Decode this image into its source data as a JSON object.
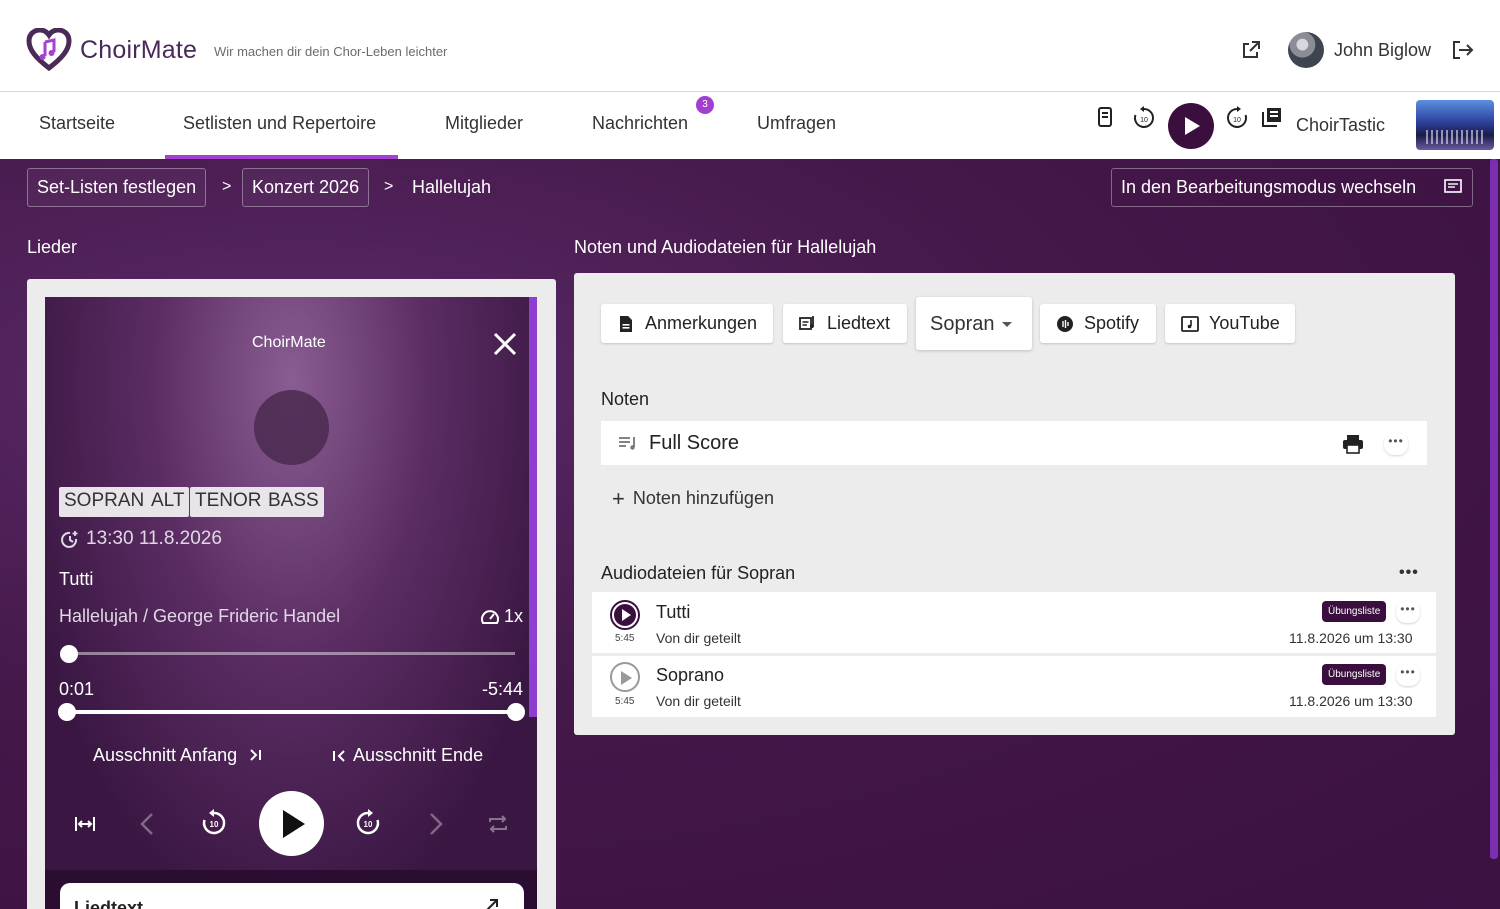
{
  "header": {
    "brand": "ChoirMate",
    "tagline": "Wir machen dir dein Chor-Leben leichter",
    "user_name": "John Biglow"
  },
  "nav": {
    "items": [
      {
        "label": "Startseite"
      },
      {
        "label": "Setlisten und Repertoire"
      },
      {
        "label": "Mitglieder"
      },
      {
        "label": "Nachrichten"
      },
      {
        "label": "Umfragen"
      }
    ],
    "active": "Setlisten und Repertoire",
    "messages_badge": "3",
    "choir_name": "ChoirTastic"
  },
  "breadcrumb": {
    "items": [
      "Set-Listen festlegen",
      "Konzert 2026"
    ],
    "current": "Hallelujah",
    "separator": ">"
  },
  "edit_button": "In den Bearbeitungsmodus wechseln",
  "left": {
    "title": "Lieder",
    "player": {
      "title": "ChoirMate",
      "voices": [
        "SOPRAN",
        "ALT",
        "TENOR",
        "BASS"
      ],
      "datetime": "13:30 11.8.2026",
      "track": "Tutti",
      "song": "Hallelujah / George Frideric Handel",
      "speed": "1x",
      "time_elapsed": "0:01",
      "time_remaining": "-5:44",
      "cut_start": "Ausschnitt Anfang",
      "cut_end": "Ausschnitt Ende",
      "progress": 0.003
    },
    "lyrics_label": "Liedtext"
  },
  "right": {
    "title": "Noten und Audiodateien für Hallelujah",
    "tabs": {
      "notes": "Anmerkungen",
      "lyrics": "Liedtext",
      "voice": "Sopran",
      "spotify": "Spotify",
      "youtube": "YouTube"
    },
    "noten_title": "Noten",
    "score_name": "Full Score",
    "add_noten": "Noten hinzufügen",
    "audio_title": "Audiodateien für Sopran",
    "audio": [
      {
        "name": "Tutti",
        "duration": "5:45",
        "shared": "Von dir geteilt",
        "tag": "Übungsliste",
        "date": "11.8.2026 um 13:30",
        "playing": true
      },
      {
        "name": "Soprano",
        "duration": "5:45",
        "shared": "Von dir geteilt",
        "tag": "Übungsliste",
        "date": "11.8.2026 um 13:30",
        "playing": false
      }
    ]
  },
  "colors": {
    "brand": "#4a2a57",
    "accent": "#a640d0",
    "background": "#441849",
    "dark_button": "#3a0f3e"
  }
}
